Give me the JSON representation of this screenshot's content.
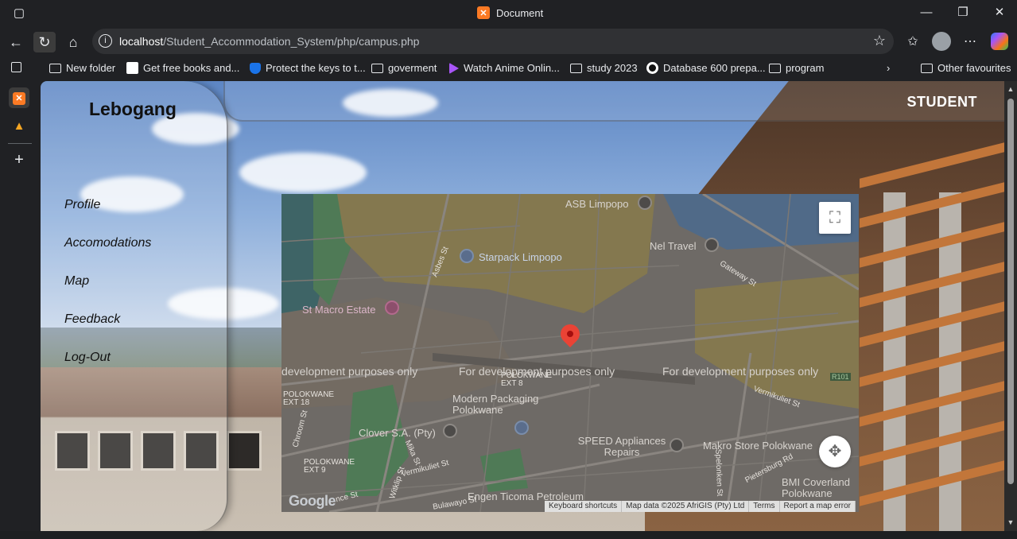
{
  "window": {
    "title": "Document",
    "controls": [
      "minimize-icon",
      "restore-icon",
      "close-icon"
    ]
  },
  "browser": {
    "url_host": "localhost",
    "url_path": "/Student_Accommodation_System/php/campus.php"
  },
  "bookmarks": [
    {
      "label": "New folder",
      "icon": "folder-icon"
    },
    {
      "label": "Get free books and...",
      "icon": "page-icon"
    },
    {
      "label": "Protect the keys to t...",
      "icon": "shield-icon"
    },
    {
      "label": "goverment",
      "icon": "folder-icon"
    },
    {
      "label": "Watch Anime Onlin...",
      "icon": "play-icon"
    },
    {
      "label": "study 2023",
      "icon": "folder-icon"
    },
    {
      "label": "Database 600 prepa...",
      "icon": "circle-icon"
    },
    {
      "label": "program",
      "icon": "folder-icon"
    },
    {
      "label": "Other favourites",
      "icon": "folder-icon"
    }
  ],
  "page": {
    "username": "Lebogang",
    "role": "STUDENT",
    "menu": [
      "Profile",
      "Accomodations",
      "Map",
      "Feedback",
      "Log-Out"
    ]
  },
  "map": {
    "places": [
      "ASB Limpopo",
      "Nel Travel",
      "Starpack Limpopo",
      "St Macro Estate",
      "Modern Packaging Polokwane",
      "Clover S.A. (Pty)",
      "SPEED Appliances Repairs",
      "Makro Store Polokwane",
      "BMI Coverland Polokwane",
      "Engen Ticoma Petroleum"
    ],
    "streets": [
      "Gateway St",
      "Asbes St",
      "Vermikuliet St",
      "Chroom St",
      "Mika St",
      "Witklip St",
      "Bulawayo St",
      "Spelonken St",
      "Pietersburg Rd",
      "nce St",
      "Gateway St"
    ],
    "areas": [
      "POLOKWANE EXT 18",
      "POLOKWANE EXT 9",
      "POLOKWANE EXT 8"
    ],
    "route_badge": "R101",
    "watermark": [
      "development purposes only",
      "For development purposes only",
      "For development purposes only"
    ],
    "logo": "Google",
    "footer": [
      "Keyboard shortcuts",
      "Map data ©2025 AfriGIS (Pty) Ltd",
      "Terms",
      "Report a map error"
    ]
  }
}
